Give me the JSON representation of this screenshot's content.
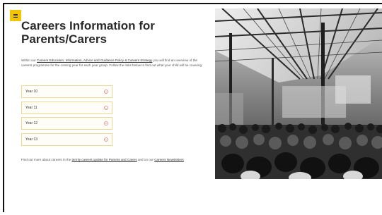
{
  "menu": {
    "icon": "hamburger-menu-icon",
    "accent": "#f3c400"
  },
  "page": {
    "title": "Careers Information for Parents/Carers",
    "intro_before": "Within our ",
    "intro_link": "Careers Education, Information, Advice and Guidance Policy & Careers Strategy",
    "intro_after": " you will find an overview of the careers programme for the coming year for each year group. Follow the links below to find out what your child will be covering."
  },
  "years": [
    {
      "label": "Year 10"
    },
    {
      "label": "Year 11"
    },
    {
      "label": "Year 12"
    },
    {
      "label": "Year 13"
    }
  ],
  "footer": {
    "text_before": "Find out more about careers in the ",
    "link1": "termly careers update for Parents and Carers",
    "text_mid": " and on our ",
    "link2": "Careers Newsletters"
  },
  "photo": {
    "description": "black-and-white audience in an industrial hall"
  },
  "colors": {
    "accent": "#f3c400",
    "border": "#f0d88a",
    "chevron": "#e59a9a"
  }
}
